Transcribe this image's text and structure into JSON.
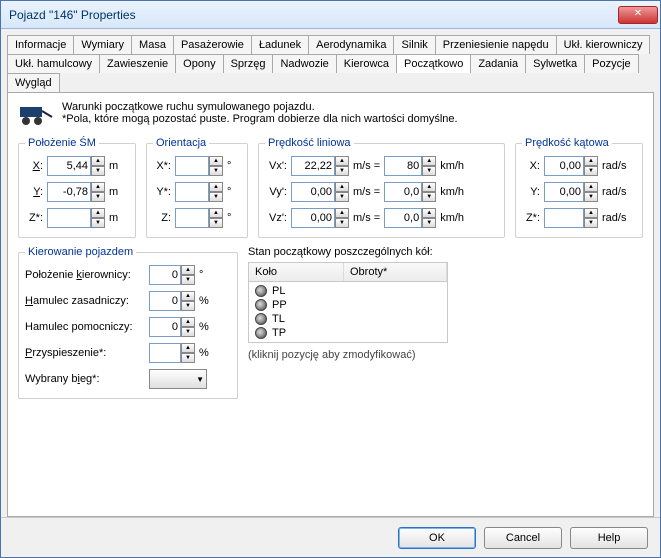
{
  "window": {
    "title": "Pojazd \"146\" Properties"
  },
  "tabs_row1": [
    "Informacje",
    "Wymiary",
    "Masa",
    "Pasażerowie",
    "Ładunek",
    "Aerodynamika",
    "Silnik",
    "Przeniesienie napędu",
    "Ukł. kierowniczy"
  ],
  "tabs_row2": [
    "Ukł. hamulcowy",
    "Zawieszenie",
    "Opony",
    "Sprzęg",
    "Nadwozie",
    "Kierowca",
    "Początkowo",
    "Zadania",
    "Sylwetka",
    "Pozycje",
    "Wygląd"
  ],
  "active_tab": "Początkowo",
  "intro": {
    "line1": "Warunki początkowe ruchu symulowanego pojazdu.",
    "line2": "*Pola, które mogą pozostać puste. Program dobierze dla nich wartości domyślne."
  },
  "polozenie_sm": {
    "legend": "Położenie ŚM",
    "x_label": "X:",
    "x_value": "5,44",
    "x_unit": "m",
    "y_label": "Y:",
    "y_value": "-0,78",
    "y_unit": "m",
    "z_label": "Z*:",
    "z_value": "",
    "z_unit": "m"
  },
  "orientacja": {
    "legend": "Orientacja",
    "x_label": "X*:",
    "x_value": "",
    "x_unit": "°",
    "y_label": "Y*:",
    "y_value": "",
    "y_unit": "°",
    "z_label": "Z:",
    "z_value": "",
    "z_unit": "°"
  },
  "predkosc_liniowa": {
    "legend": "Prędkość liniowa",
    "vx_label": "Vx':",
    "vx_ms": "22,22",
    "vx_kmh": "80",
    "vy_label": "Vy':",
    "vy_ms": "0,00",
    "vy_kmh": "0,0",
    "vz_label": "Vz':",
    "vz_ms": "0,00",
    "vz_kmh": "0,0",
    "ms_unit": "m/s =",
    "kmh_unit": "km/h"
  },
  "predkosc_katowa": {
    "legend": "Prędkość kątowa",
    "x_label": "X:",
    "x_value": "0,00",
    "unit": "rad/s",
    "y_label": "Y:",
    "y_value": "0,00",
    "z_label": "Z*:",
    "z_value": ""
  },
  "kierowanie": {
    "legend": "Kierowanie pojazdem",
    "poloz_label": "Położenie kierownicy:",
    "poloz_val": "0",
    "poloz_unit": "°",
    "hamz_label": "Hamulec zasadniczy:",
    "hamz_val": "0",
    "hamz_unit": "%",
    "hamp_label": "Hamulec pomocniczy:",
    "hamp_val": "0",
    "hamp_unit": "%",
    "przy_label": "Przyspieszenie*:",
    "przy_val": "",
    "przy_unit": "%",
    "bieg_label": "Wybrany bieg*:"
  },
  "stan_kol": {
    "label": "Stan początkowy poszczególnych kół:",
    "col_kolo": "Koło",
    "col_obroty": "Obroty*",
    "rows": [
      "PL",
      "PP",
      "TL",
      "TP"
    ],
    "hint": "(kliknij pozycję aby zmodyfikować)"
  },
  "footer": {
    "ok": "OK",
    "cancel": "Cancel",
    "help": "Help"
  }
}
